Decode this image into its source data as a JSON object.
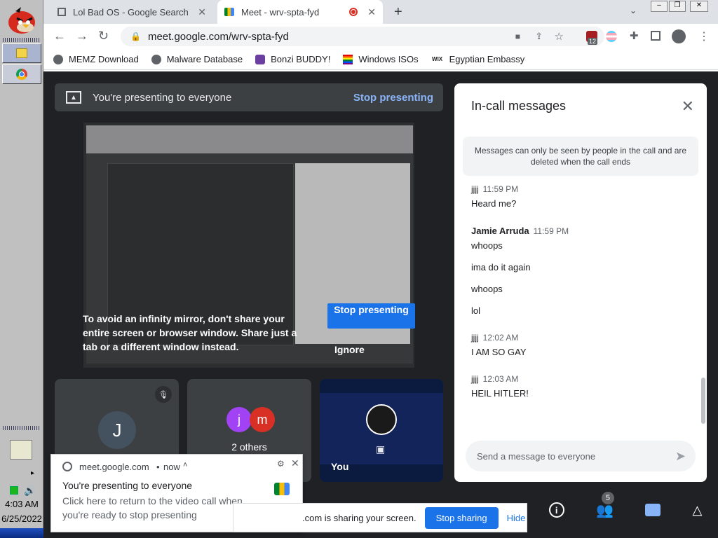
{
  "taskbar": {
    "time": "4:03 AM",
    "date": "6/25/2022"
  },
  "browser": {
    "tabs": [
      {
        "title": "Lol Bad OS - Google Search"
      },
      {
        "title": "Meet - wrv-spta-fyd"
      }
    ],
    "url": "meet.google.com/wrv-spta-fyd",
    "extension_badge": "12",
    "bookmarks": [
      {
        "label": "MEMZ Download"
      },
      {
        "label": "Malware Database"
      },
      {
        "label": "Bonzi BUDDY!"
      },
      {
        "label": "Windows ISOs"
      },
      {
        "label": "Egyptian Embassy"
      }
    ]
  },
  "meet": {
    "banner": {
      "text": "You're presenting to everyone",
      "stop": "Stop presenting"
    },
    "preview": {
      "warning": "To avoid an infinity mirror, don't share your entire screen or browser window. Share just a tab or a different window instead.",
      "stop": "Stop presenting",
      "ignore": "Ignore"
    },
    "tiles": {
      "j_initial": "J",
      "others_initials": [
        "j",
        "m"
      ],
      "others_label": "2 others",
      "you_label": "You"
    },
    "participants_count": "5"
  },
  "chat": {
    "title": "In-call messages",
    "notice": "Messages can only be seen by people in the call and are deleted when the call ends",
    "messages": [
      {
        "sender": "jjjj",
        "time": "11:59 PM",
        "lines": [
          "Heard me?"
        ]
      },
      {
        "sender": "Jamie Arruda",
        "time": "11:59 PM",
        "lines": [
          "whoops",
          "ima do it again",
          "whoops",
          "lol"
        ]
      },
      {
        "sender": "jjjj",
        "time": "12:02 AM",
        "lines": [
          "I AM SO GAY"
        ]
      },
      {
        "sender": "jjjj",
        "time": "12:03 AM",
        "lines": [
          "HEIL HITLER!"
        ]
      }
    ],
    "input_placeholder": "Send a message to everyone"
  },
  "toast": {
    "source": "meet.google.com",
    "when": "now",
    "title": "You're presenting to everyone",
    "body": "Click here to return to the video call when you're ready to stop presenting"
  },
  "sharebar": {
    "text": ".com is sharing your screen.",
    "stop": "Stop sharing",
    "hide": "Hide"
  }
}
